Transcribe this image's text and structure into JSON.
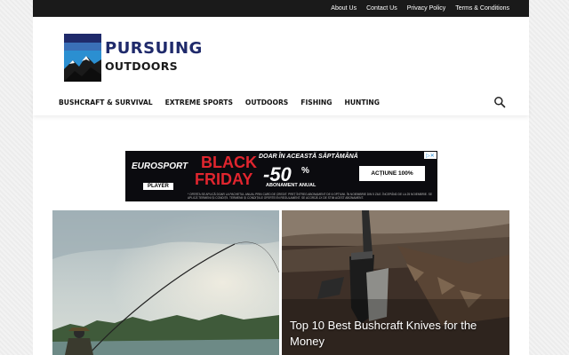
{
  "topbar": {
    "links": [
      "About Us",
      "Contact Us",
      "Privacy Policy",
      "Terms & Conditions"
    ]
  },
  "logo": {
    "line1": "PURSUING",
    "line2": "OUTDOORS",
    "colors": {
      "navy": "#1f2a6b",
      "sky": "#2b8fd1"
    }
  },
  "nav": {
    "items": [
      "BUSHCRAFT & SURVIVAL",
      "EXTREME SPORTS",
      "OUTDOORS",
      "FISHING",
      "HUNTING"
    ],
    "search_icon": "search-icon"
  },
  "ad": {
    "brand": "EUROSPORT",
    "player": "PLAYER",
    "black": "BLACK",
    "friday": "FRIDAY",
    "headline": "DOAR ÎN ACEASTĂ SĂPTĂMÂNĂ",
    "discount": "-50",
    "percent": "%",
    "subline": "ABONAMENT ANUAL",
    "cta": "ACȚIUNE 100%",
    "legal": "* OFERTA SE APLICĂ DOAR LA PACHETUL ANUAL PRIN CARD DE CREDIT. PREȚ ÎNTREG ABONAMENT DE 6 OPȚIUNI. ÎN NOIEMBRIE DIN 5 ZILE. ÎNCEPÂND DE LA 25 NOIEMBRIE. SE APLICĂ TERMENI ȘI CONDIȚII. TERMENII ȘI CONDIȚIILE OFERTEI ÎN REGULAMENT. SE ACORDĂ 1X DE STIM ACEST ABONAMENT.",
    "choices": "▷✕",
    "colors": {
      "red": "#e0252e",
      "background": "#0b0b0f"
    }
  },
  "featured": [
    {
      "title": ""
    },
    {
      "title": "Top 10 Best Bushcraft Knives for the Money"
    }
  ]
}
